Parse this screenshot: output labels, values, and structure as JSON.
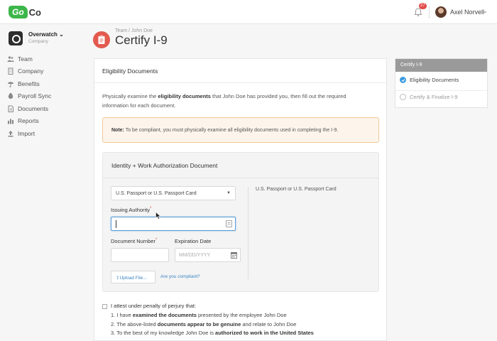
{
  "app": {
    "logo_go": "Go",
    "logo_co": "Co"
  },
  "topbar": {
    "notifications": "27",
    "user_name": "Axel Norvell"
  },
  "company": {
    "name": "Overwatch",
    "subtitle": "Company"
  },
  "nav": [
    {
      "label": "Team",
      "icon": "team-icon"
    },
    {
      "label": "Company",
      "icon": "building-icon"
    },
    {
      "label": "Benefits",
      "icon": "umbrella-icon"
    },
    {
      "label": "Payroll Sync",
      "icon": "money-icon"
    },
    {
      "label": "Documents",
      "icon": "document-icon"
    },
    {
      "label": "Reports",
      "icon": "bar-chart-icon"
    },
    {
      "label": "Import",
      "icon": "upload-icon"
    }
  ],
  "header": {
    "breadcrumb": "Team  /  John Doe",
    "title": "Certify I-9"
  },
  "card": {
    "title": "Eligibility Documents",
    "intro_1": "Physically examine the ",
    "intro_bold": "eligibility documents",
    "intro_2": " that John Doe has provided you, then fill out the required information for each document.",
    "note_label": "Note:",
    "note_text": " To be compliant, you must physically examine all eligibility documents used in completing the I-9."
  },
  "document": {
    "section_title": "Identity + Work Authorization Document",
    "type_value": "U.S. Passport or U.S. Passport Card",
    "summary": "U.S. Passport or U.S. Passport Card",
    "issuing_label": "Issuing Authority",
    "doc_number_label": "Document Number",
    "expiration_label": "Expiration Date",
    "expiration_placeholder": "MM/DD/YYYY",
    "upload_label": "Upload File...",
    "compliant_link": "Are you compliant?"
  },
  "attest": {
    "title": "I attest under penalty of perjury that:",
    "item1_a": "1. I have ",
    "item1_b": "examined the documents",
    "item1_c": " presented by the employee John Doe",
    "item2_a": "2. The above-listed ",
    "item2_b": "documents appear to be genuine",
    "item2_c": " and relate to John Doe",
    "item3_a": "3. To the best of my knowledge John Doe is ",
    "item3_b": "authorized to work in the United States"
  },
  "steps": {
    "header": "Certify I-9",
    "step1": "Eligibility Documents",
    "step2": "Certify & Finalize I-9"
  },
  "colors": {
    "brand": "#3cb64a",
    "accent": "#3b84c4",
    "title_icon": "#e35a4f",
    "note_border": "#f0c898"
  }
}
